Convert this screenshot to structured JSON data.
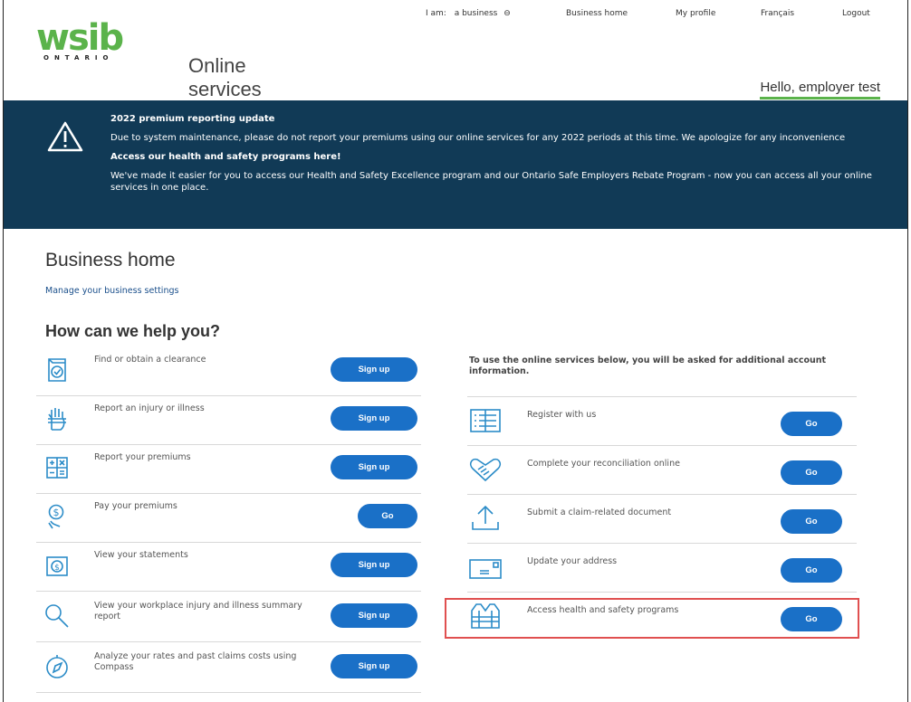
{
  "topnav": {
    "iam_label": "I am:",
    "iam_value": "a business",
    "iam_icon": "chevron-circle-icon",
    "business_home": "Business home",
    "my_profile": "My profile",
    "francais": "Français",
    "logout": "Logout"
  },
  "logo": {
    "word": "wsib",
    "ontario": "ONTARIO",
    "services": "Online services"
  },
  "greeting": "Hello, employer test",
  "banner": {
    "icon": "warning-triangle-icon",
    "title1": "2022 premium reporting update",
    "body1": "Due to system maintenance, please do not report your premiums using our online services for any 2022 periods at this time. We apologize for any inconvenience",
    "title2": "Access our health and safety programs here!",
    "body2": "We've made it easier for you to access our Health and Safety Excellence program and our Ontario Safe Employers Rebate Program - now you can access all your online services in one place."
  },
  "page_title": "Business home",
  "manage_link": "Manage your business settings",
  "help_title": "How can we help you?",
  "right_note": "To use the online services below, you will be asked for additional account information.",
  "left_services": [
    {
      "label": "Find or obtain a clearance",
      "button": "Sign up",
      "icon": "clearance-certificate-icon"
    },
    {
      "label": "Report an injury or illness",
      "button": "Sign up",
      "icon": "injured-hand-icon"
    },
    {
      "label": "Report your premiums",
      "button": "Sign up",
      "icon": "calculator-icon"
    },
    {
      "label": "Pay your premiums",
      "button": "Go",
      "icon": "pay-dollar-hand-icon"
    },
    {
      "label": "View your statements",
      "button": "Sign up",
      "icon": "statement-dollar-icon"
    },
    {
      "label": "View your workplace injury and illness summary report",
      "button": "Sign up",
      "icon": "magnifier-icon"
    },
    {
      "label": "Analyze your rates and past claims costs using Compass",
      "button": "Sign up",
      "icon": "compass-icon"
    }
  ],
  "right_services": [
    {
      "label": "Register with us",
      "button": "Go",
      "icon": "register-form-icon"
    },
    {
      "label": "Complete your reconciliation online",
      "button": "Go",
      "icon": "handshake-heart-icon"
    },
    {
      "label": "Submit a claim-related document",
      "button": "Go",
      "icon": "upload-icon"
    },
    {
      "label": "Update your address",
      "button": "Go",
      "icon": "mail-envelope-icon"
    },
    {
      "label": "Access health and safety programs",
      "button": "Go",
      "icon": "safety-vest-icon"
    }
  ],
  "colors": {
    "brand_green": "#5bb34b",
    "banner_navy": "#113a56",
    "button_blue": "#1a70c7",
    "highlight_red": "#e05050"
  }
}
